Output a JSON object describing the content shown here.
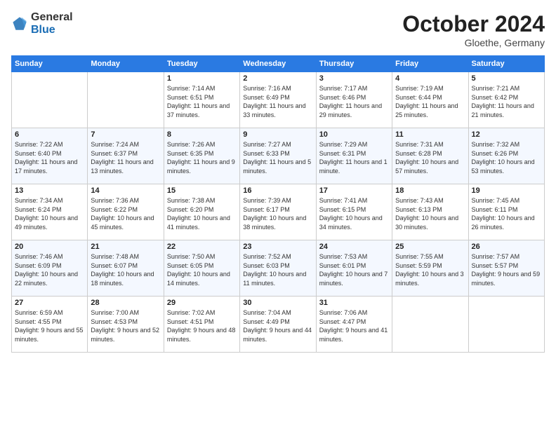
{
  "header": {
    "logo_general": "General",
    "logo_blue": "Blue",
    "month_title": "October 2024",
    "location": "Gloethe, Germany"
  },
  "weekdays": [
    "Sunday",
    "Monday",
    "Tuesday",
    "Wednesday",
    "Thursday",
    "Friday",
    "Saturday"
  ],
  "weeks": [
    {
      "days": [
        {
          "num": "",
          "empty": true
        },
        {
          "num": "",
          "empty": true
        },
        {
          "num": "1",
          "sunrise": "7:14 AM",
          "sunset": "6:51 PM",
          "daylight": "11 hours and 37 minutes."
        },
        {
          "num": "2",
          "sunrise": "7:16 AM",
          "sunset": "6:49 PM",
          "daylight": "11 hours and 33 minutes."
        },
        {
          "num": "3",
          "sunrise": "7:17 AM",
          "sunset": "6:46 PM",
          "daylight": "11 hours and 29 minutes."
        },
        {
          "num": "4",
          "sunrise": "7:19 AM",
          "sunset": "6:44 PM",
          "daylight": "11 hours and 25 minutes."
        },
        {
          "num": "5",
          "sunrise": "7:21 AM",
          "sunset": "6:42 PM",
          "daylight": "11 hours and 21 minutes."
        }
      ]
    },
    {
      "days": [
        {
          "num": "6",
          "sunrise": "7:22 AM",
          "sunset": "6:40 PM",
          "daylight": "11 hours and 17 minutes."
        },
        {
          "num": "7",
          "sunrise": "7:24 AM",
          "sunset": "6:37 PM",
          "daylight": "11 hours and 13 minutes."
        },
        {
          "num": "8",
          "sunrise": "7:26 AM",
          "sunset": "6:35 PM",
          "daylight": "11 hours and 9 minutes."
        },
        {
          "num": "9",
          "sunrise": "7:27 AM",
          "sunset": "6:33 PM",
          "daylight": "11 hours and 5 minutes."
        },
        {
          "num": "10",
          "sunrise": "7:29 AM",
          "sunset": "6:31 PM",
          "daylight": "11 hours and 1 minute."
        },
        {
          "num": "11",
          "sunrise": "7:31 AM",
          "sunset": "6:28 PM",
          "daylight": "10 hours and 57 minutes."
        },
        {
          "num": "12",
          "sunrise": "7:32 AM",
          "sunset": "6:26 PM",
          "daylight": "10 hours and 53 minutes."
        }
      ]
    },
    {
      "days": [
        {
          "num": "13",
          "sunrise": "7:34 AM",
          "sunset": "6:24 PM",
          "daylight": "10 hours and 49 minutes."
        },
        {
          "num": "14",
          "sunrise": "7:36 AM",
          "sunset": "6:22 PM",
          "daylight": "10 hours and 45 minutes."
        },
        {
          "num": "15",
          "sunrise": "7:38 AM",
          "sunset": "6:20 PM",
          "daylight": "10 hours and 41 minutes."
        },
        {
          "num": "16",
          "sunrise": "7:39 AM",
          "sunset": "6:17 PM",
          "daylight": "10 hours and 38 minutes."
        },
        {
          "num": "17",
          "sunrise": "7:41 AM",
          "sunset": "6:15 PM",
          "daylight": "10 hours and 34 minutes."
        },
        {
          "num": "18",
          "sunrise": "7:43 AM",
          "sunset": "6:13 PM",
          "daylight": "10 hours and 30 minutes."
        },
        {
          "num": "19",
          "sunrise": "7:45 AM",
          "sunset": "6:11 PM",
          "daylight": "10 hours and 26 minutes."
        }
      ]
    },
    {
      "days": [
        {
          "num": "20",
          "sunrise": "7:46 AM",
          "sunset": "6:09 PM",
          "daylight": "10 hours and 22 minutes."
        },
        {
          "num": "21",
          "sunrise": "7:48 AM",
          "sunset": "6:07 PM",
          "daylight": "10 hours and 18 minutes."
        },
        {
          "num": "22",
          "sunrise": "7:50 AM",
          "sunset": "6:05 PM",
          "daylight": "10 hours and 14 minutes."
        },
        {
          "num": "23",
          "sunrise": "7:52 AM",
          "sunset": "6:03 PM",
          "daylight": "10 hours and 11 minutes."
        },
        {
          "num": "24",
          "sunrise": "7:53 AM",
          "sunset": "6:01 PM",
          "daylight": "10 hours and 7 minutes."
        },
        {
          "num": "25",
          "sunrise": "7:55 AM",
          "sunset": "5:59 PM",
          "daylight": "10 hours and 3 minutes."
        },
        {
          "num": "26",
          "sunrise": "7:57 AM",
          "sunset": "5:57 PM",
          "daylight": "9 hours and 59 minutes."
        }
      ]
    },
    {
      "days": [
        {
          "num": "27",
          "sunrise": "6:59 AM",
          "sunset": "4:55 PM",
          "daylight": "9 hours and 55 minutes."
        },
        {
          "num": "28",
          "sunrise": "7:00 AM",
          "sunset": "4:53 PM",
          "daylight": "9 hours and 52 minutes."
        },
        {
          "num": "29",
          "sunrise": "7:02 AM",
          "sunset": "4:51 PM",
          "daylight": "9 hours and 48 minutes."
        },
        {
          "num": "30",
          "sunrise": "7:04 AM",
          "sunset": "4:49 PM",
          "daylight": "9 hours and 44 minutes."
        },
        {
          "num": "31",
          "sunrise": "7:06 AM",
          "sunset": "4:47 PM",
          "daylight": "9 hours and 41 minutes."
        },
        {
          "num": "",
          "empty": true
        },
        {
          "num": "",
          "empty": true
        }
      ]
    }
  ]
}
